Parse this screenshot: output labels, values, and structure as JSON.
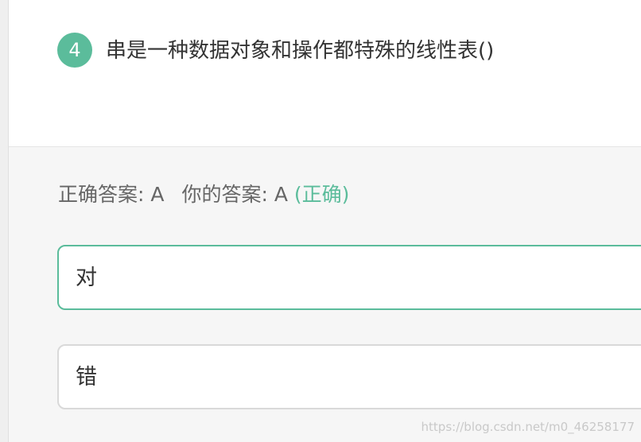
{
  "question": {
    "number": "4",
    "text": "串是一种数据对象和操作都特殊的线性表()"
  },
  "answer": {
    "correct_label": "正确答案: ",
    "correct_value": "A",
    "yours_label": "你的答案: ",
    "yours_value": "A",
    "result": "(正确)"
  },
  "options": [
    {
      "label": "对"
    },
    {
      "label": "错"
    }
  ],
  "watermark": "https://blog.csdn.net/m0_46258177",
  "colors": {
    "accent": "#5bbc9b",
    "text": "#333333",
    "muted": "#666666",
    "answer_bg": "#f6f6f6"
  }
}
